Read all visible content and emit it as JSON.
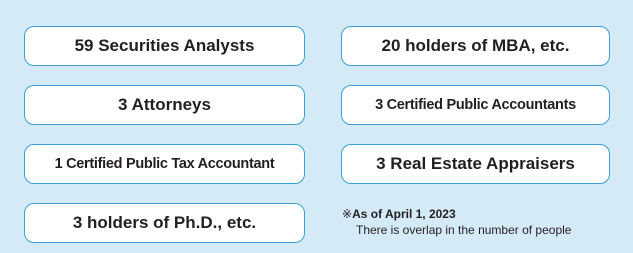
{
  "badges": {
    "securities_analysts": "59 Securities Analysts",
    "mba_holders": "20 holders of MBA, etc.",
    "attorneys": "3 Attorneys",
    "cpas": "3 Certified Public Accountants",
    "tax_accountant": "1 Certified Public Tax Accountant",
    "real_estate_appraisers": "3 Real Estate Appraisers",
    "phd_holders": "3 holders of Ph.D., etc."
  },
  "note": {
    "mark": "※",
    "date": "As of April 1, 2023",
    "overlap": "There is overlap in the number of people"
  },
  "colors": {
    "panel_background": "#d4ebf7",
    "badge_border": "#3aa0d8",
    "badge_background": "#ffffff",
    "text": "#231f20"
  }
}
